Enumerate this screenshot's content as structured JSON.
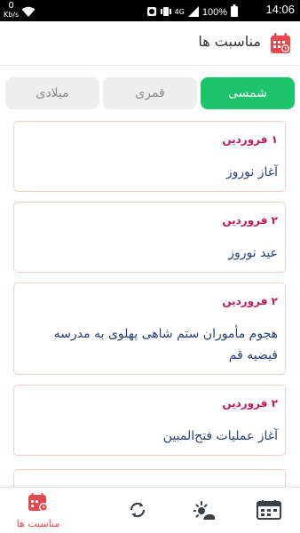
{
  "status_bar": {
    "speed_value": "0",
    "speed_unit": "Kb/s",
    "network": "4G",
    "battery": "100%",
    "time": "14:06"
  },
  "header": {
    "title": "مناسبت ها",
    "icon": "calendar-icon"
  },
  "tabs": [
    {
      "label": "شمسی",
      "active": true
    },
    {
      "label": "قمری",
      "active": false
    },
    {
      "label": "میلادی",
      "active": false
    }
  ],
  "events": [
    {
      "date": "۱ فروردین",
      "title": "آغاز نوروز"
    },
    {
      "date": "۲ فروردین",
      "title": "عید نوروز"
    },
    {
      "date": "۲ فروردین",
      "title": "هجوم مأموران ستم شاهی پهلوی به مدرسه فیضیه قم"
    },
    {
      "date": "۲ فروردین",
      "title": "آغاز عملیات فتح‌المبین"
    }
  ],
  "bottom_nav": {
    "occasions_label": "مناسبت ها",
    "items": [
      "calendar-occasions-icon",
      "sync-icon",
      "weather-icon",
      "calendar-grid-icon"
    ]
  },
  "colors": {
    "accent_green": "#1cc56b",
    "accent_red": "#e5484d",
    "date_color": "#c2185b",
    "title_color": "#2a3f7a",
    "card_border": "#f3cccc"
  }
}
